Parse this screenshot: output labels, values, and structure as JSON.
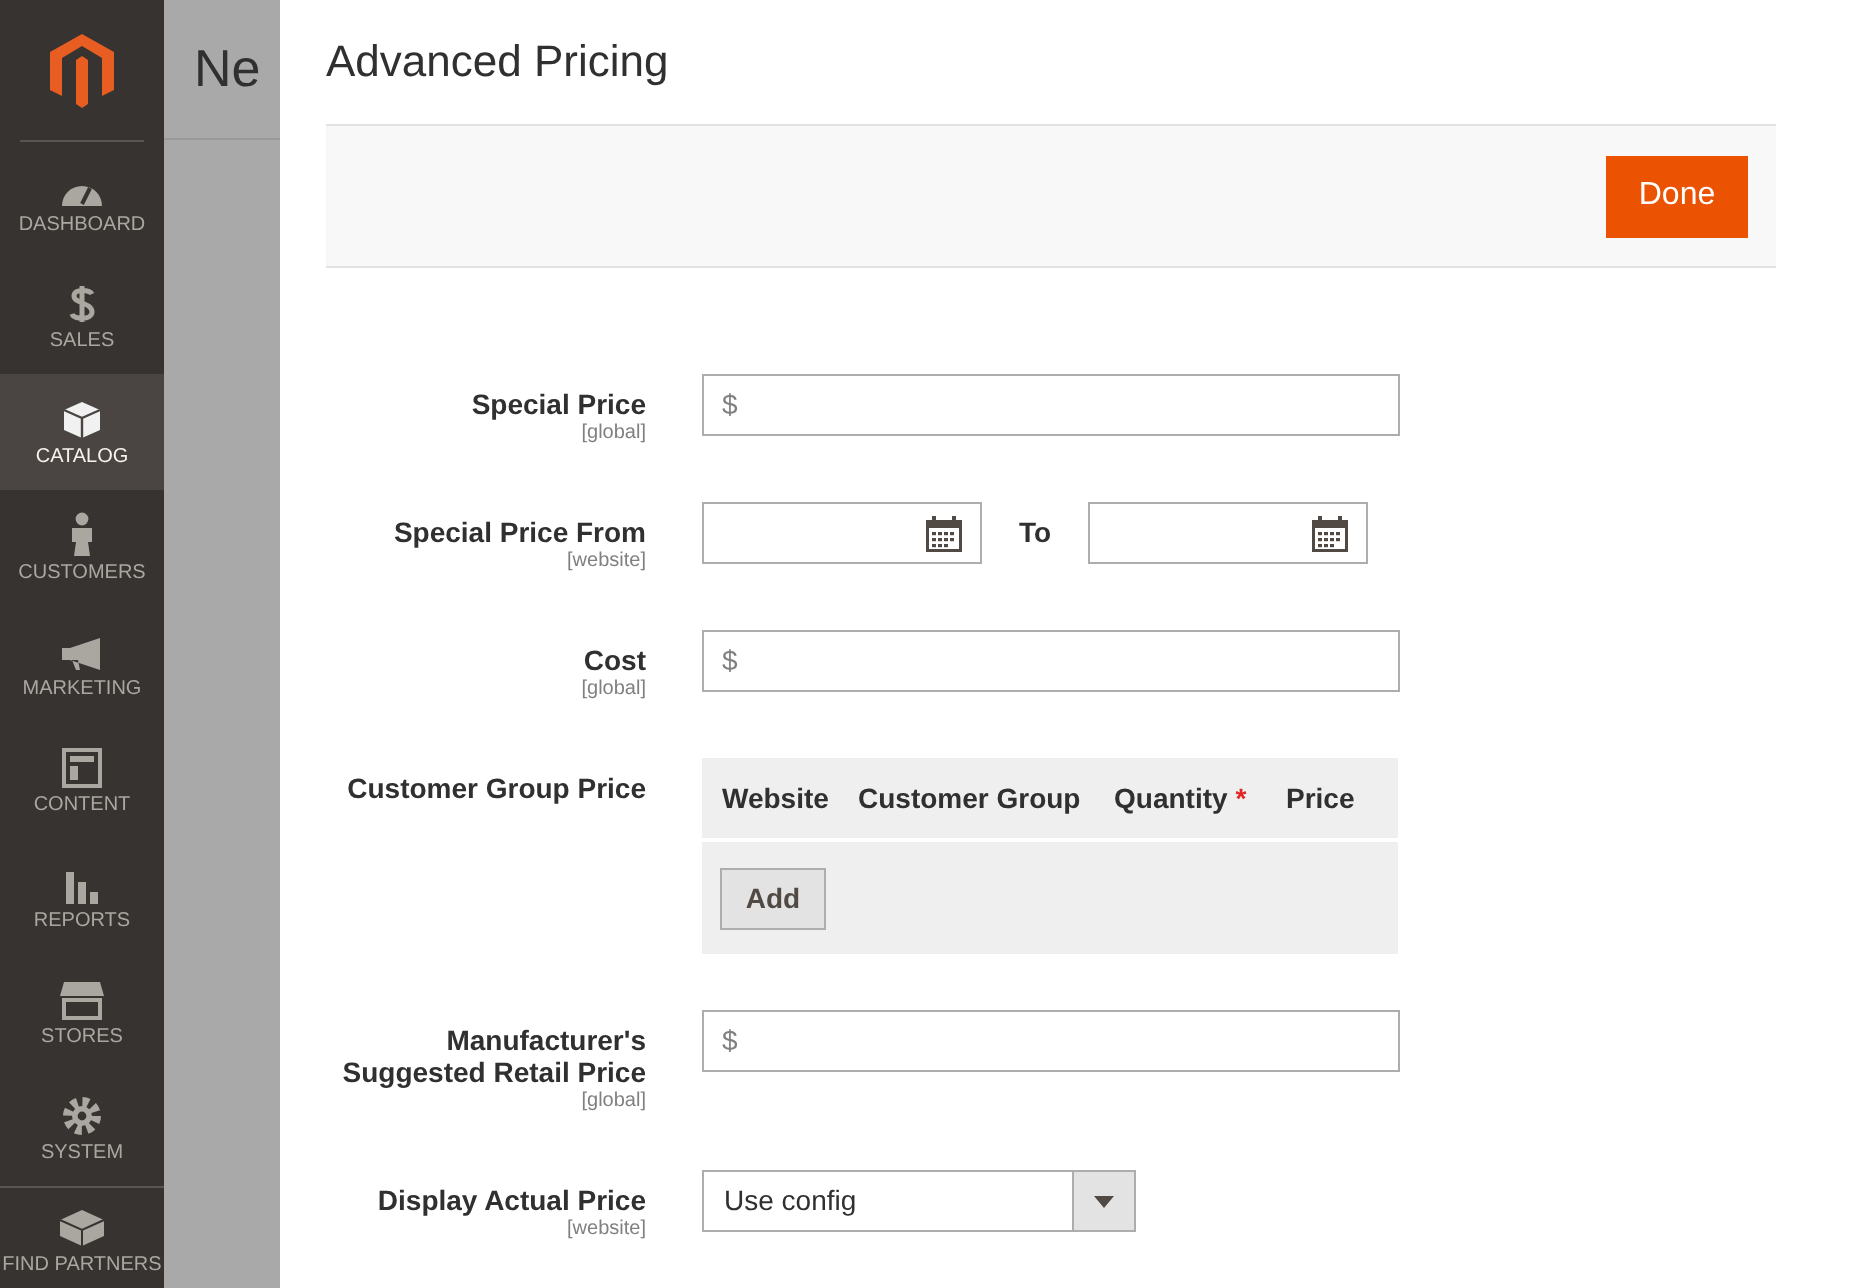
{
  "sidebar": {
    "items": [
      {
        "label": "DASHBOARD",
        "selected": false
      },
      {
        "label": "SALES",
        "selected": false
      },
      {
        "label": "CATALOG",
        "selected": true
      },
      {
        "label": "CUSTOMERS",
        "selected": false
      },
      {
        "label": "MARKETING",
        "selected": false
      },
      {
        "label": "CONTENT",
        "selected": false
      },
      {
        "label": "REPORTS",
        "selected": false
      },
      {
        "label": "STORES",
        "selected": false
      },
      {
        "label": "SYSTEM",
        "selected": false
      },
      {
        "label": "FIND PARTNERS",
        "selected": false
      }
    ]
  },
  "page_title": "Ne",
  "modal": {
    "title": "Advanced Pricing",
    "done_button": "Done",
    "fields": [
      {
        "kind": "text",
        "label": "Special Price",
        "scope": "[global]",
        "prefix": "$"
      },
      {
        "kind": "daterange",
        "label": "Special Price From",
        "scope": "[website]",
        "separator": "To"
      },
      {
        "kind": "text",
        "label": "Cost",
        "scope": "[global]",
        "prefix": "$"
      },
      {
        "kind": "grid",
        "label": "Customer Group Price",
        "columns": [
          {
            "label": "Website",
            "required": false
          },
          {
            "label": "Customer Group",
            "required": false
          },
          {
            "label": "Quantity",
            "required": true
          },
          {
            "label": "Price",
            "required": false
          }
        ],
        "required_mark": "*",
        "add_button": "Add"
      },
      {
        "kind": "text",
        "label": "Manufacturer's Suggested Retail Price",
        "scope": "[global]",
        "prefix": "$"
      },
      {
        "kind": "select",
        "label": "Display Actual Price",
        "scope": "[website]",
        "value": "Use config"
      }
    ]
  }
}
